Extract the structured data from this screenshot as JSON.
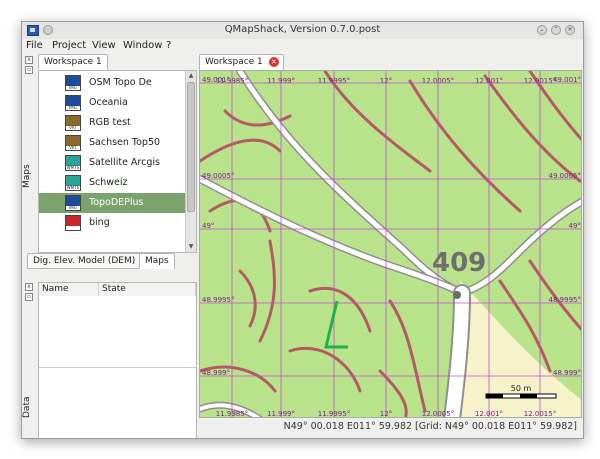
{
  "window": {
    "title": "QMapShack, Version 0.7.0.post"
  },
  "menu": [
    "File",
    "Project",
    "View",
    "Window",
    "?"
  ],
  "left": {
    "workspace_tab": "Workspace 1",
    "maps_label": "Maps",
    "data_label": "Data",
    "maps": [
      {
        "label": "OSM Topo De",
        "cap": "IMG",
        "color": "#1e4b9a"
      },
      {
        "label": "Oceania",
        "cap": "IMG",
        "color": "#1e4b9a"
      },
      {
        "label": "RGB test",
        "cap": "VRT",
        "color": "#8a6a2a"
      },
      {
        "label": "Sachsen Top50",
        "cap": "VRT",
        "color": "#8a6a2a"
      },
      {
        "label": "Satellite Arcgis",
        "cap": "WMTS",
        "color": "#2aa39a"
      },
      {
        "label": "Schweiz",
        "cap": "WMTS",
        "color": "#2aa39a"
      },
      {
        "label": "TopoDEPlus",
        "cap": "IMG",
        "color": "#1e4b9a",
        "selected": true
      },
      {
        "label": "bing",
        "cap": "",
        "color": "#c22a2a"
      }
    ],
    "bottom_tabs": [
      "Dig. Elev. Model (DEM)",
      "Maps"
    ],
    "columns": [
      "Name",
      "State"
    ]
  },
  "map": {
    "tab": "Workspace 1",
    "lon_labels": [
      "11.9985°",
      "11.999°",
      "11.9995°",
      "12°",
      "12.0005°",
      "12.001°",
      "12.0015°"
    ],
    "lat_labels": [
      "49.001°",
      "49.0005°",
      "49°",
      "48.9995°",
      "48.999°"
    ],
    "elevation": "409",
    "scale": "50 m",
    "colors": {
      "land": "#b9e38a",
      "road": "#a3a3a3",
      "contour": "#b45a64",
      "grid": "#c44cd0"
    }
  },
  "status": "N49° 00.018 E011° 59.982 [Grid: N49° 00.018 E011° 59.982]"
}
